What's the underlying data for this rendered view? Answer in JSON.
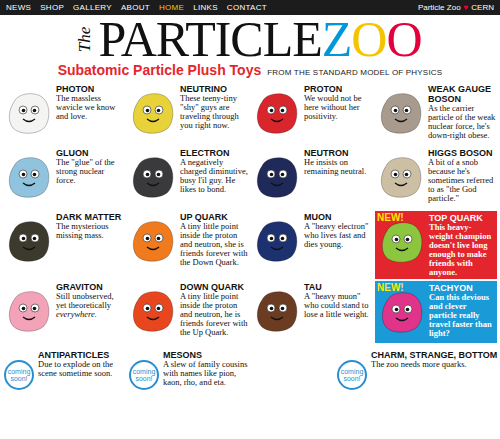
{
  "nav": {
    "items": [
      {
        "label": "NEWS",
        "selected": false
      },
      {
        "label": "SHOP",
        "selected": false
      },
      {
        "label": "GALLERY",
        "selected": false
      },
      {
        "label": "ABOUT",
        "selected": false
      },
      {
        "label": "HOME",
        "selected": true
      },
      {
        "label": "LINKS",
        "selected": false
      },
      {
        "label": "CONTACT",
        "selected": false
      }
    ],
    "brand_left": "Particle Zoo",
    "brand_heart": "♥",
    "brand_right": "CERN"
  },
  "header": {
    "the": "The",
    "title_main": "PARTICLE",
    "title_accent": "ZOO",
    "subtitle": "Subatomic Particle Plush Toys",
    "tagline": "FROM THE STANDARD MODEL OF PHYSICS"
  },
  "particles": [
    {
      "name": "PHOTON",
      "desc": "The massless wavicle we know and love.",
      "color": "#f4f4f2",
      "kind": "plain"
    },
    {
      "name": "NEUTRINO",
      "desc": "These teeny-tiny \"shy\" guys are traveling through you right now.",
      "color": "#e8d23a",
      "kind": "plain"
    },
    {
      "name": "PROTON",
      "desc": "We would not be here without her positivity.",
      "color": "#d8262c",
      "kind": "plain"
    },
    {
      "name": "WEAK GAUGE BOSON",
      "desc": "As the carrier particle of the weak nuclear force, he's down-right obese.",
      "color": "#a89a8c",
      "kind": "plain"
    },
    {
      "name": "GLUON",
      "desc": "The \"glue\" of the strong nuclear force.",
      "color": "#8fc3de",
      "kind": "plain"
    },
    {
      "name": "ELECTRON",
      "desc": "A negatively charged diminutive, busy l'il guy. He likes to bond.",
      "color": "#3a3a3c",
      "kind": "plain"
    },
    {
      "name": "NEUTRON",
      "desc": "He insists on remaining neutral.",
      "color": "#1f2a5a",
      "kind": "plain"
    },
    {
      "name": "HIGGS BOSON",
      "desc": "A bit of a snob because he's sometimes referred to as \"the God particle.\"",
      "color": "#cdbfa4",
      "kind": "plain"
    },
    {
      "name": "DARK MATTER",
      "desc": "The mysterious missing mass.",
      "color": "#3b3a2c",
      "kind": "plain"
    },
    {
      "name": "UP QUARK",
      "desc": "A tiny little point inside the proton and neutron, she is friends forever with the Down Quark.",
      "color": "#f07a1e",
      "kind": "plain"
    },
    {
      "name": "MUON",
      "desc": "A \"heavy electron\" who lives fast and dies young.",
      "color": "#1d3170",
      "kind": "plain"
    },
    {
      "name": "TOP QUARK",
      "desc": "This heavy-weight champion doesn't live long enough to make friends with anyone.",
      "color": "#8cc63f",
      "kind": "featured",
      "badge": "NEW!",
      "box_color": "#e3262d"
    },
    {
      "name": "GRAVITON",
      "desc": "Still unobserved, yet theoretically",
      "em": "everywhere.",
      "color": "#f2a3b8",
      "kind": "plain"
    },
    {
      "name": "DOWN QUARK",
      "desc": "A tiny little point inside the proton and neutron, he is friends forever with the Up Quark.",
      "color": "#e8461e",
      "kind": "plain"
    },
    {
      "name": "TAU",
      "desc": "A \"heavy muon\" who could stand to lose a little weight.",
      "color": "#6b3b22",
      "kind": "plain"
    },
    {
      "name": "TACHYON",
      "desc": "Can this devious and clever particle really travel faster than light?",
      "color": "#e0338a",
      "kind": "featured",
      "badge": "NEW!",
      "box_color": "#1a9ad6"
    }
  ],
  "coming_soon": [
    {
      "badge": "coming soon!",
      "name": "ANTIPARTICLES",
      "desc": "Due to explode on the scene sometime soon."
    },
    {
      "badge": "coming soon!",
      "name": "MESONS",
      "desc": "A slew of family cousins with names like pion, kaon, rho, and eta."
    },
    {
      "badge": "coming soon!",
      "name": "CHARM, STRANGE, BOTTOM",
      "desc": "The zoo needs more quarks."
    }
  ]
}
